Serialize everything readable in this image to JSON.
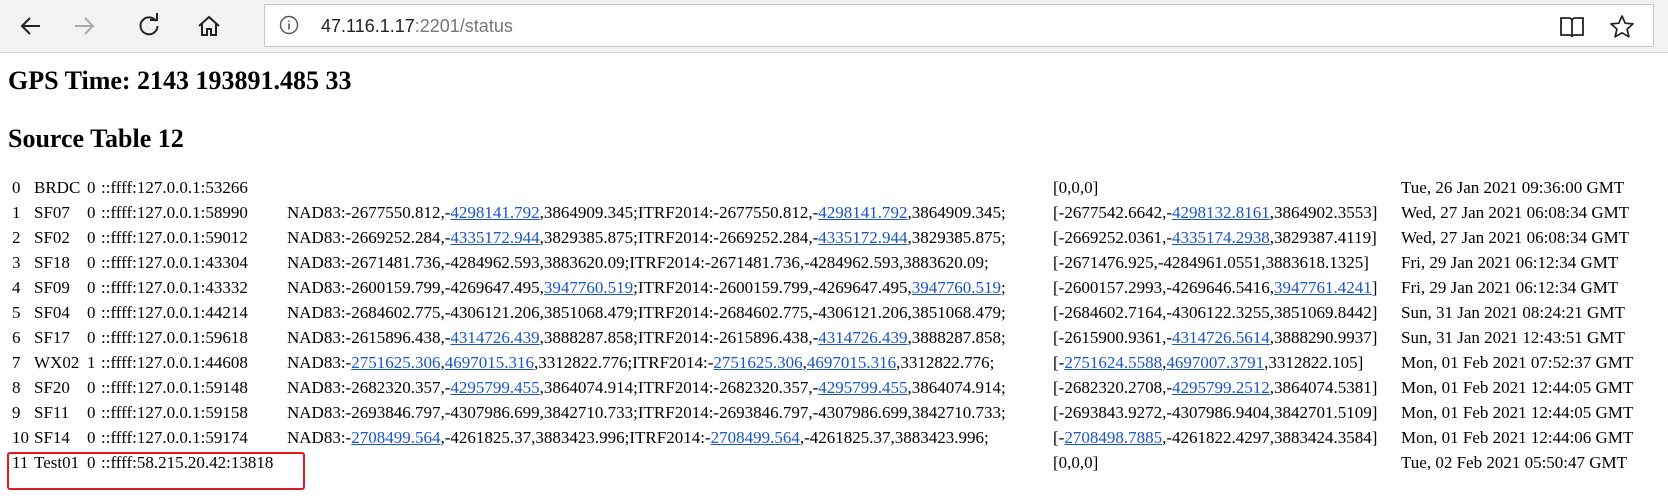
{
  "browser": {
    "url_host": "47.116.1.17",
    "url_rest": ":2201/status"
  },
  "page": {
    "gps_time": "GPS Time: 2143 193891.485 33",
    "source_table": "Source Table 12"
  },
  "rows": [
    {
      "idx": "0",
      "name": "BRDC",
      "num": "0",
      "addr": "::ffff:127.0.0.1:53266",
      "nad": [],
      "arr": [
        {
          "t": "[0,0,0]"
        }
      ],
      "time": "Tue, 26 Jan 2021 09:36:00 GMT"
    },
    {
      "idx": "1",
      "name": "SF07",
      "num": "0",
      "addr": "::ffff:127.0.0.1:58990",
      "nad": [
        {
          "t": "NAD83:-2677550.812,-"
        },
        {
          "t": "4298141.792",
          "link": true
        },
        {
          "t": ",3864909.345;ITRF2014:-2677550.812,-"
        },
        {
          "t": "4298141.792",
          "link": true
        },
        {
          "t": ",3864909.345;"
        }
      ],
      "arr": [
        {
          "t": "[-2677542.6642,-"
        },
        {
          "t": "4298132.8161",
          "link": true
        },
        {
          "t": ",3864902.3553]"
        }
      ],
      "time": "Wed, 27 Jan 2021 06:08:34 GMT"
    },
    {
      "idx": "2",
      "name": "SF02",
      "num": "0",
      "addr": "::ffff:127.0.0.1:59012",
      "nad": [
        {
          "t": "NAD83:-2669252.284,-"
        },
        {
          "t": "4335172.944",
          "link": true
        },
        {
          "t": ",3829385.875;ITRF2014:-2669252.284,-"
        },
        {
          "t": "4335172.944",
          "link": true
        },
        {
          "t": ",3829385.875;"
        }
      ],
      "arr": [
        {
          "t": "[-2669252.0361,-"
        },
        {
          "t": "4335174.2938",
          "link": true
        },
        {
          "t": ",3829387.4119]"
        }
      ],
      "time": "Wed, 27 Jan 2021 06:08:34 GMT"
    },
    {
      "idx": "3",
      "name": "SF18",
      "num": "0",
      "addr": "::ffff:127.0.0.1:43304",
      "nad": [
        {
          "t": "NAD83:-2671481.736,-4284962.593,3883620.09;ITRF2014:-2671481.736,-4284962.593,3883620.09;"
        }
      ],
      "arr": [
        {
          "t": "[-2671476.925,-4284961.0551,3883618.1325]"
        }
      ],
      "time": "Fri, 29 Jan 2021 06:12:34 GMT"
    },
    {
      "idx": "4",
      "name": "SF09",
      "num": "0",
      "addr": "::ffff:127.0.0.1:43332",
      "nad": [
        {
          "t": "NAD83:-2600159.799,-4269647.495,"
        },
        {
          "t": "3947760.519",
          "link": true
        },
        {
          "t": ";ITRF2014:-2600159.799,-4269647.495,"
        },
        {
          "t": "3947760.519",
          "link": true
        },
        {
          "t": ";"
        }
      ],
      "arr": [
        {
          "t": "[-2600157.2993,-4269646.5416,"
        },
        {
          "t": "3947761.4241",
          "link": true
        },
        {
          "t": "]"
        }
      ],
      "time": "Fri, 29 Jan 2021 06:12:34 GMT"
    },
    {
      "idx": "5",
      "name": "SF04",
      "num": "0",
      "addr": "::ffff:127.0.0.1:44214",
      "nad": [
        {
          "t": "NAD83:-2684602.775,-4306121.206,3851068.479;ITRF2014:-2684602.775,-4306121.206,3851068.479;"
        }
      ],
      "arr": [
        {
          "t": "[-2684602.7164,-4306122.3255,3851069.8442]"
        }
      ],
      "time": "Sun, 31 Jan 2021 08:24:21 GMT"
    },
    {
      "idx": "6",
      "name": "SF17",
      "num": "0",
      "addr": "::ffff:127.0.0.1:59618",
      "nad": [
        {
          "t": "NAD83:-2615896.438,-"
        },
        {
          "t": "4314726.439",
          "link": true
        },
        {
          "t": ",3888287.858;ITRF2014:-2615896.438,-"
        },
        {
          "t": "4314726.439",
          "link": true
        },
        {
          "t": ",3888287.858;"
        }
      ],
      "arr": [
        {
          "t": "[-2615900.9361,-"
        },
        {
          "t": "4314726.5614",
          "link": true
        },
        {
          "t": ",3888290.9937]"
        }
      ],
      "time": "Sun, 31 Jan 2021 12:43:51 GMT"
    },
    {
      "idx": "7",
      "name": "WX02",
      "num": "1",
      "addr": "::ffff:127.0.0.1:44608",
      "nad": [
        {
          "t": "NAD83:-"
        },
        {
          "t": "2751625.306",
          "link": true
        },
        {
          "t": ","
        },
        {
          "t": "4697015.316",
          "link": true
        },
        {
          "t": ",3312822.776;ITRF2014:-"
        },
        {
          "t": "2751625.306",
          "link": true
        },
        {
          "t": ","
        },
        {
          "t": "4697015.316",
          "link": true
        },
        {
          "t": ",3312822.776;"
        }
      ],
      "arr": [
        {
          "t": "[-"
        },
        {
          "t": "2751624.5588",
          "link": true
        },
        {
          "t": ","
        },
        {
          "t": "4697007.3791",
          "link": true
        },
        {
          "t": ",3312822.105]"
        }
      ],
      "time": "Mon, 01 Feb 2021 07:52:37 GMT"
    },
    {
      "idx": "8",
      "name": "SF20",
      "num": "0",
      "addr": "::ffff:127.0.0.1:59148",
      "nad": [
        {
          "t": "NAD83:-2682320.357,-"
        },
        {
          "t": "4295799.455",
          "link": true
        },
        {
          "t": ",3864074.914;ITRF2014:-2682320.357,-"
        },
        {
          "t": "4295799.455",
          "link": true
        },
        {
          "t": ",3864074.914;"
        }
      ],
      "arr": [
        {
          "t": "[-2682320.2708,-"
        },
        {
          "t": "4295799.2512",
          "link": true
        },
        {
          "t": ",3864074.5381]"
        }
      ],
      "time": "Mon, 01 Feb 2021 12:44:05 GMT"
    },
    {
      "idx": "9",
      "name": "SF11",
      "num": "0",
      "addr": "::ffff:127.0.0.1:59158",
      "nad": [
        {
          "t": "NAD83:-2693846.797,-4307986.699,3842710.733;ITRF2014:-2693846.797,-4307986.699,3842710.733;"
        }
      ],
      "arr": [
        {
          "t": "[-2693843.9272,-4307986.9404,3842701.5109]"
        }
      ],
      "time": "Mon, 01 Feb 2021 12:44:05 GMT"
    },
    {
      "idx": "10",
      "name": "SF14",
      "num": "0",
      "addr": "::ffff:127.0.0.1:59174",
      "nad": [
        {
          "t": "NAD83:-"
        },
        {
          "t": "2708499.564",
          "link": true
        },
        {
          "t": ",-4261825.37,3883423.996;ITRF2014:-"
        },
        {
          "t": "2708499.564",
          "link": true
        },
        {
          "t": ",-4261825.37,3883423.996;"
        }
      ],
      "arr": [
        {
          "t": "[-"
        },
        {
          "t": "2708498.7885",
          "link": true
        },
        {
          "t": ",-4261822.4297,3883424.3584]"
        }
      ],
      "time": "Mon, 01 Feb 2021 12:44:06 GMT"
    },
    {
      "idx": "11",
      "name": "Test01",
      "num": "0",
      "addr": "::ffff:58.215.20.42:13818",
      "nad": [],
      "arr": [
        {
          "t": "[0,0,0]"
        }
      ],
      "time": "Tue, 02 Feb 2021 05:50:47 GMT"
    }
  ]
}
